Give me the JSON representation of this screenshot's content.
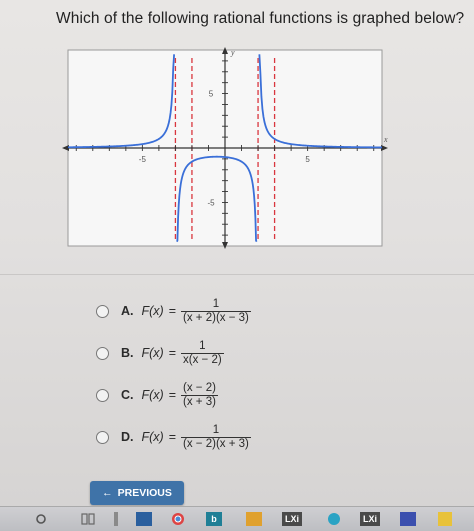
{
  "question": "Which of the following rational functions is graphed below?",
  "graph": {
    "x_label": "x",
    "y_label": "y",
    "tick_labels": {
      "x_neg": "-5",
      "x_pos": "5",
      "y_pos": "5",
      "y_neg": "-5"
    },
    "asymptotes_x": [
      -3,
      -2,
      2,
      3
    ],
    "curve_color": "#3a6fd8",
    "asymptote_color": "#d9363e"
  },
  "choices": [
    {
      "letter": "A.",
      "fx": "F(x)",
      "eq": "=",
      "num": "1",
      "den": "(x + 2)(x − 3)"
    },
    {
      "letter": "B.",
      "fx": "F(x)",
      "eq": "=",
      "num": "1",
      "den": "x(x − 2)"
    },
    {
      "letter": "C.",
      "fx": "F(x)",
      "eq": "=",
      "num": "(x − 2)",
      "den": "(x + 3)"
    },
    {
      "letter": "D.",
      "fx": "F(x)",
      "eq": "=",
      "num": "1",
      "den": "(x − 2)(x + 3)"
    }
  ],
  "previous_button": {
    "arrow": "←",
    "label": "PREVIOUS"
  },
  "taskbar": {
    "items": [
      "search-icon",
      "task-view-icon",
      "folder-icon",
      "store-icon",
      "chrome-icon",
      "bing-icon",
      "files-icon",
      "lxi-app-icon",
      "edge-icon",
      "lxi-app-icon-2",
      "mail-icon",
      "notes-icon"
    ],
    "lxi_label": "LXi"
  }
}
